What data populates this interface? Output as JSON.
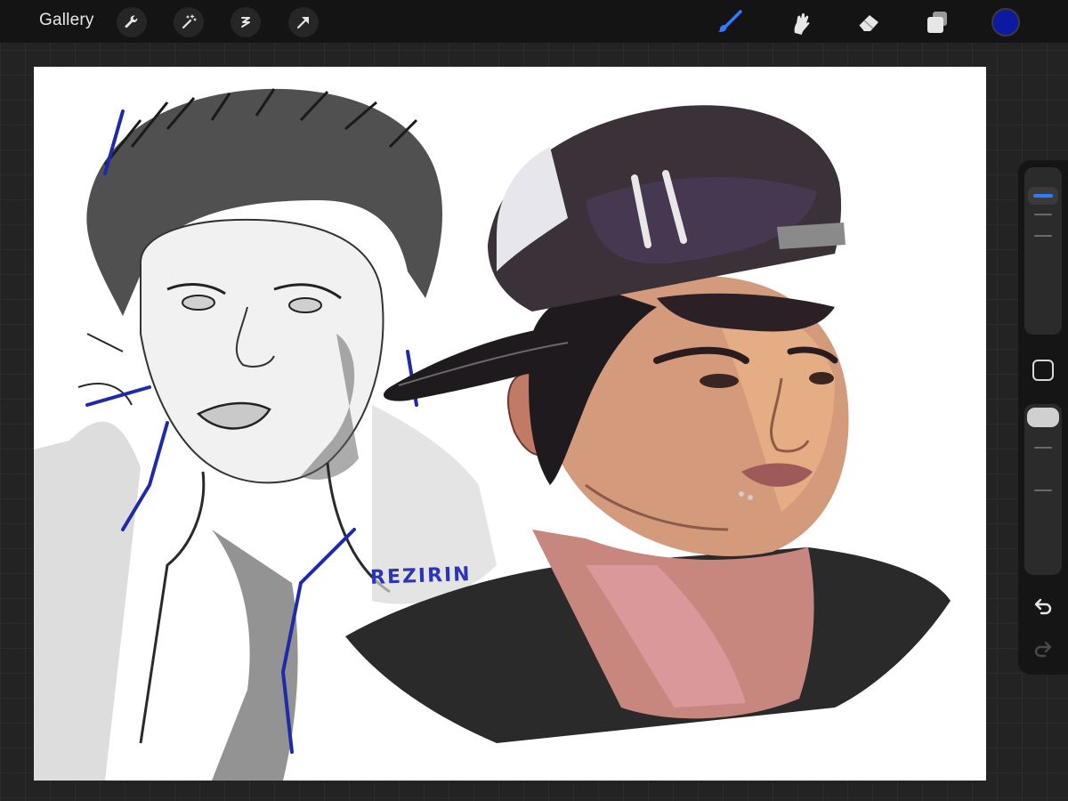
{
  "toolbar": {
    "gallery_label": "Gallery",
    "left_tools": [
      {
        "icon": "wrench-icon"
      },
      {
        "icon": "magic-wand-icon"
      },
      {
        "icon": "selection-icon"
      },
      {
        "icon": "transform-arrow-icon"
      }
    ],
    "right_tools": [
      {
        "icon": "brush-icon",
        "active": true
      },
      {
        "icon": "smudge-icon",
        "active": false
      },
      {
        "icon": "eraser-icon",
        "active": false
      },
      {
        "icon": "layers-icon",
        "active": false
      }
    ],
    "current_color": "#0b1aa0"
  },
  "canvas": {
    "signature_text": "REZIRIN"
  },
  "sidebar": {
    "brush_size_level": 0.88,
    "opacity_level": 0.92,
    "modify_icon": "modify-square-icon",
    "undo_icon": "undo-icon",
    "redo_icon": "redo-icon"
  },
  "colors": {
    "accent_blue": "#2f7bff",
    "toolbar_bg": "#141414"
  }
}
